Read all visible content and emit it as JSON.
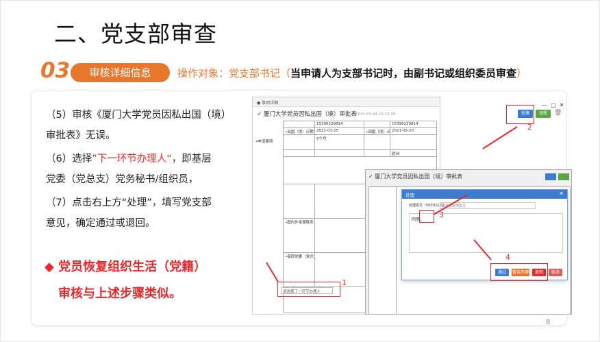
{
  "title": "二、党支部审查",
  "section": {
    "number": "03",
    "pill": "审核详细信息",
    "target_prefix": "操作对象：党支部书记（",
    "target_bold": "当申请人为支部书记时，由副书记或组织委员审查",
    "target_suffix": "）"
  },
  "steps": {
    "s5a": "（5）审核《厦门大学党员因私出国（境）",
    "s5b": "审批表》无误。",
    "s6a_pre": "（6）选择",
    "s6a_red": "”下一环节办理人“",
    "s6a_post": "，即基层",
    "s6b": "党委（党总支）党务秘书/组织员，",
    "s7a": "（7）点击右上方“处理”，填写党支部",
    "s7b": "意见，确定通过或退回。"
  },
  "highlight": {
    "line1": "◆ 党员恢复组织生活（党籍）",
    "line2": "审核与上述步骤类似。"
  },
  "page_number": "8",
  "screenshot1": {
    "bar": "● 事项详细",
    "header": "✓ 厦门大学党员因私出国（境）审批表",
    "timestamp": "2021-03-24 11:12:00",
    "phone": "15396229814",
    "phone2": "15396229814",
    "date_from": "2021-03-25",
    "date_to": "2021-05-20",
    "duration": "5个月",
    "dest": "欧洲",
    "label_out": "•出国（境）日期",
    "label_back": "•回国（境）日期",
    "label_apply": "•申请事项",
    "label_contact": "•国内外亲属联系人",
    "label_branch": "•基层党委（党总支）意见",
    "next_handler": "请选择下一环节办理人",
    "btn_process": "处理",
    "btn_return": "流程",
    "mark1": "1",
    "mark2": "2"
  },
  "screenshot2": {
    "header": "✓ 厦门大学党员因私出国（境）审批表",
    "dialog_title": "处理",
    "select_label": "处理意见（500字以内）",
    "select_placeholder": "请选择常用意见",
    "opinion": "同意。",
    "btn_ok": "通过",
    "btn_save": "暂存办理",
    "btn_back": "退回",
    "btn_cancel": "取消",
    "mark3": "3",
    "mark4": "4"
  },
  "colors": {
    "accent": "#e8772e",
    "red": "#e8292b",
    "blue": "#3b7bd0",
    "green": "#5aa646"
  }
}
